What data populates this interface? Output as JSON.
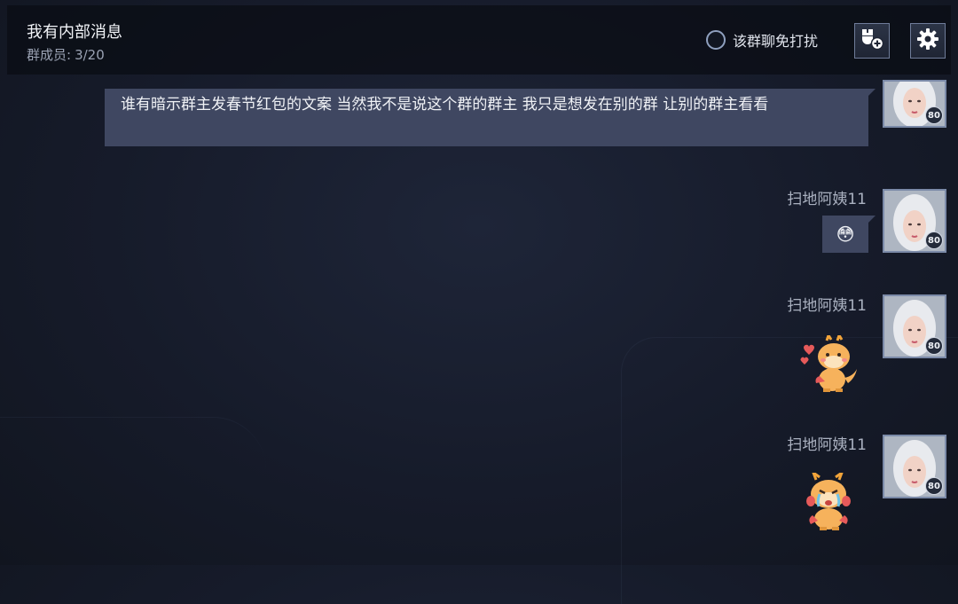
{
  "header": {
    "title": "我有内部消息",
    "members_label": "群成员:",
    "members_count": "3/20",
    "mute_label": "该群聊免打扰"
  },
  "messages": [
    {
      "text": "谁有暗示群主发春节红包的文案 当然我不是说这个群的群主 我只是想发在别的群 让别的群主看看",
      "level": "80"
    },
    {
      "sender": "扫地阿姨11",
      "emoji": "😳",
      "level": "80"
    },
    {
      "sender": "扫地阿姨11",
      "sticker": "dragon-love-sticker",
      "level": "80"
    },
    {
      "sender": "扫地阿姨11",
      "sticker": "dragon-cry-sticker",
      "level": "80"
    }
  ],
  "colors": {
    "bubble": "#3f4761",
    "header_bg": "#0a0d14",
    "accent_border": "#7b8aa8"
  },
  "icons": [
    "add-member-icon",
    "settings-gear-icon"
  ]
}
